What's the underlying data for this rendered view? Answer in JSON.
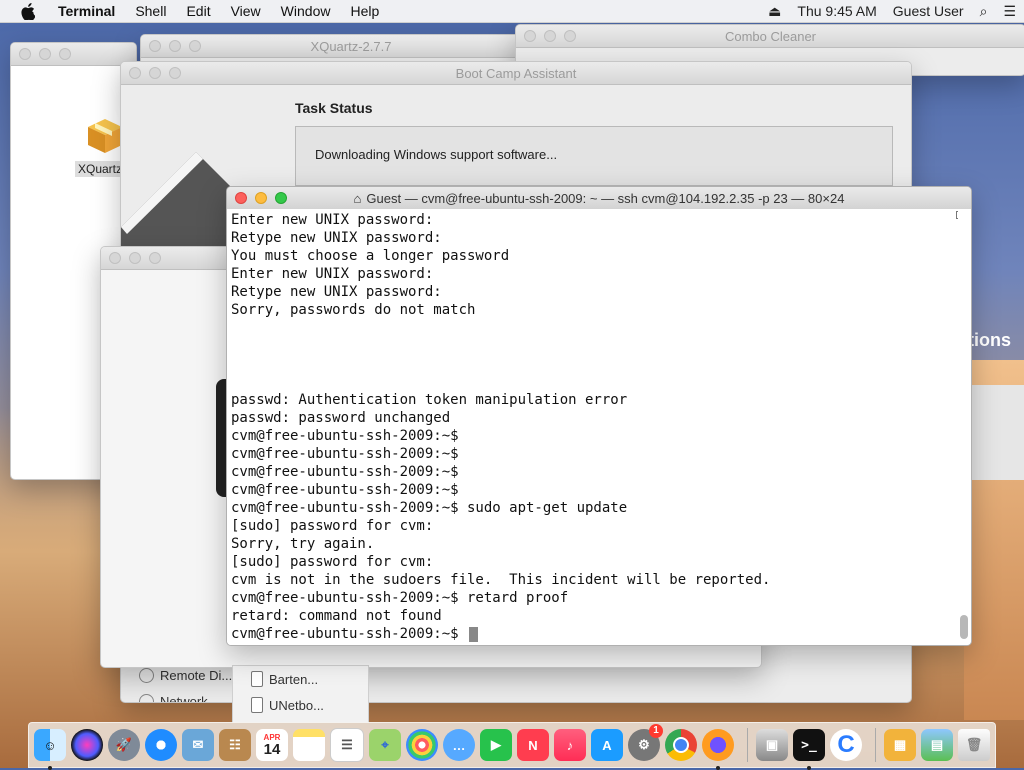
{
  "menubar": {
    "app": "Terminal",
    "items": [
      "Shell",
      "Edit",
      "View",
      "Window",
      "Help"
    ],
    "clock": "Thu 9:45 AM",
    "user": "Guest User"
  },
  "desktop": {
    "file_label": "XQuartz.p",
    "partial_text": "tions"
  },
  "windows": {
    "xquartz_title": "XQuartz-2.7.7",
    "combo_title": "Combo Cleaner",
    "bootcamp_title": "Boot Camp Assistant",
    "bootcamp_heading": "Task Status",
    "bootcamp_status": "Downloading Windows support software...",
    "bootcamp_sidebar": [
      "Remote Di...",
      "Network"
    ],
    "mini_sidebar": [
      "Barten...",
      "UNetbo..."
    ]
  },
  "terminal": {
    "title": "Guest — cvm@free-ubuntu-ssh-2009: ~ — ssh cvm@104.192.2.35 -p 23 — 80×24",
    "lines": [
      "Enter new UNIX password:",
      "Retype new UNIX password:",
      "You must choose a longer password",
      "Enter new UNIX password:",
      "Retype new UNIX password:",
      "Sorry, passwords do not match",
      "",
      "",
      "",
      "",
      "passwd: Authentication token manipulation error",
      "passwd: password unchanged",
      "cvm@free-ubuntu-ssh-2009:~$",
      "cvm@free-ubuntu-ssh-2009:~$",
      "cvm@free-ubuntu-ssh-2009:~$",
      "cvm@free-ubuntu-ssh-2009:~$",
      "cvm@free-ubuntu-ssh-2009:~$ sudo apt-get update",
      "[sudo] password for cvm:",
      "Sorry, try again.",
      "[sudo] password for cvm:",
      "cvm is not in the sudoers file.  This incident will be reported.",
      "cvm@free-ubuntu-ssh-2009:~$ retard proof",
      "retard: command not found",
      "cvm@free-ubuntu-ssh-2009:~$ "
    ]
  },
  "dock": {
    "calendar_month": "APR",
    "calendar_day": "14",
    "badge": "1",
    "icons": [
      "finder-icon",
      "siri-icon",
      "launchpad-icon",
      "safari-icon",
      "preview-icon",
      "contacts-icon",
      "calendar-icon",
      "notes-icon",
      "reminders-icon",
      "maps-icon",
      "photos-icon",
      "messages-icon",
      "facetime-icon",
      "news-icon",
      "music-icon",
      "app-store-icon",
      "system-preferences-icon",
      "chrome-icon",
      "firefox-icon",
      "disk-utility-icon",
      "terminal-icon",
      "combo-cleaner-icon",
      "package-icon",
      "preview-folder-icon",
      "trash-icon"
    ]
  }
}
